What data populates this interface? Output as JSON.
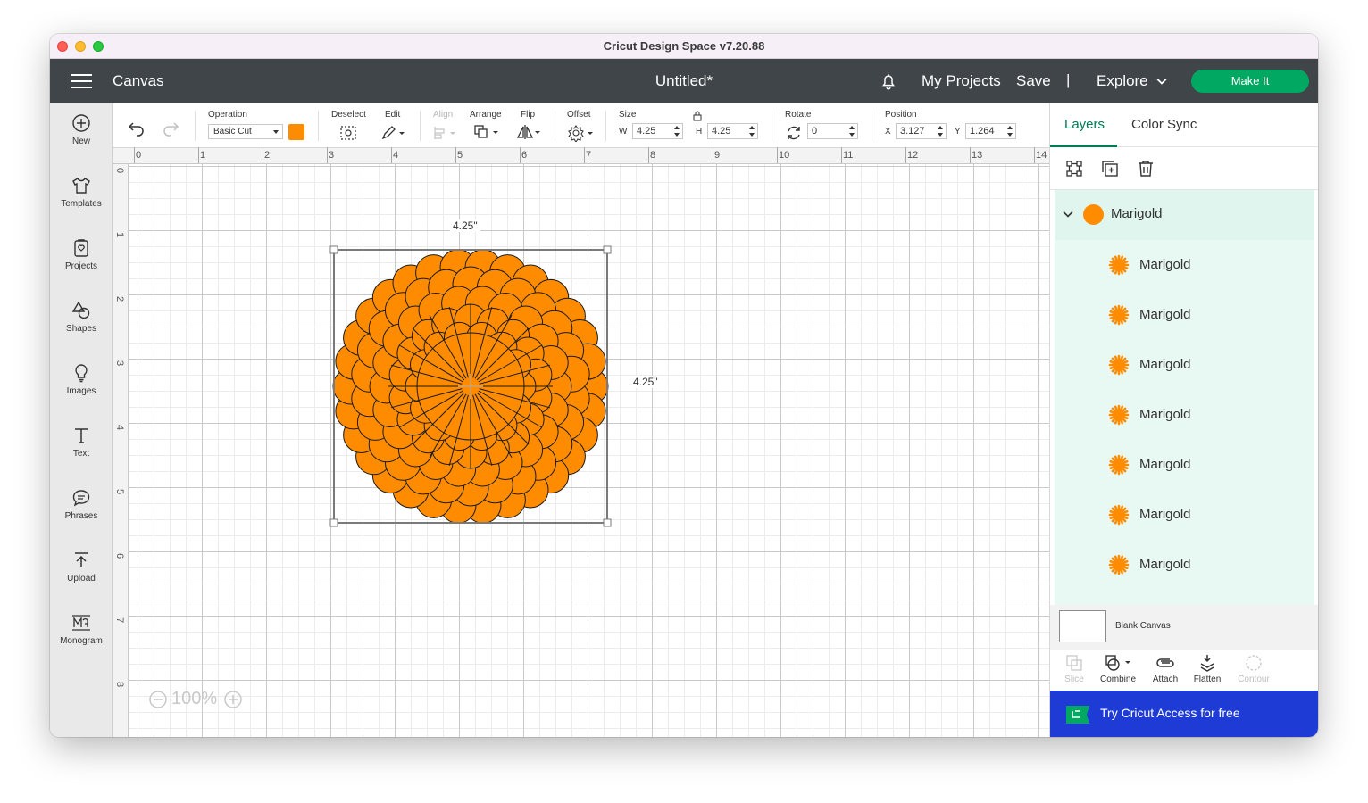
{
  "window": {
    "title": "Cricut Design Space  v7.20.88"
  },
  "topbar": {
    "section": "Canvas",
    "document": "Untitled*",
    "my_projects": "My Projects",
    "save": "Save",
    "separator": "|",
    "explore": "Explore",
    "make_it": "Make It"
  },
  "sidebar": {
    "items": [
      {
        "label": "New",
        "icon": "plus-circle-icon"
      },
      {
        "label": "Templates",
        "icon": "tshirt-icon"
      },
      {
        "label": "Projects",
        "icon": "projects-icon"
      },
      {
        "label": "Shapes",
        "icon": "shapes-icon"
      },
      {
        "label": "Images",
        "icon": "lightbulb-icon"
      },
      {
        "label": "Text",
        "icon": "text-icon"
      },
      {
        "label": "Phrases",
        "icon": "speech-bubble-icon"
      },
      {
        "label": "Upload",
        "icon": "upload-icon"
      },
      {
        "label": "Monogram",
        "icon": "monogram-icon"
      }
    ]
  },
  "toolbar": {
    "operation_label": "Operation",
    "operation_value": "Basic Cut",
    "operation_color": "#ff8c00",
    "deselect_label": "Deselect",
    "edit_label": "Edit",
    "align_label": "Align",
    "arrange_label": "Arrange",
    "flip_label": "Flip",
    "offset_label": "Offset",
    "size_label": "Size",
    "w_label": "W",
    "w_value": "4.25",
    "h_label": "H",
    "h_value": "4.25",
    "rotate_label": "Rotate",
    "rotate_value": "0",
    "position_label": "Position",
    "x_label": "X",
    "x_value": "3.127",
    "y_label": "Y",
    "y_value": "1.264"
  },
  "rulers": {
    "top": [
      "0",
      "1",
      "2",
      "3",
      "4",
      "5",
      "6",
      "7",
      "8",
      "9",
      "10",
      "11",
      "12",
      "13",
      "14"
    ],
    "left": [
      "0",
      "1",
      "2",
      "3",
      "4",
      "5",
      "6",
      "7",
      "8"
    ]
  },
  "canvas": {
    "width_label": "4.25\"",
    "height_label": "4.25\"",
    "zoom": "100%",
    "zoom_out": "−",
    "zoom_in": "+",
    "flower_color": "#ff8c00"
  },
  "layers_panel": {
    "tabs": [
      "Layers",
      "Color Sync"
    ],
    "group": {
      "name": "Marigold",
      "color": "#ff8c00"
    },
    "layers": [
      "Marigold",
      "Marigold",
      "Marigold",
      "Marigold",
      "Marigold",
      "Marigold",
      "Marigold"
    ],
    "blank_canvas": "Blank Canvas",
    "actions": [
      "Slice",
      "Combine",
      "Attach",
      "Flatten",
      "Contour"
    ],
    "promo": "Try Cricut Access for free"
  },
  "colors": {
    "accent": "#007a53",
    "make_it": "#00a862",
    "promo": "#1f3bd6",
    "topbar": "#404549"
  }
}
